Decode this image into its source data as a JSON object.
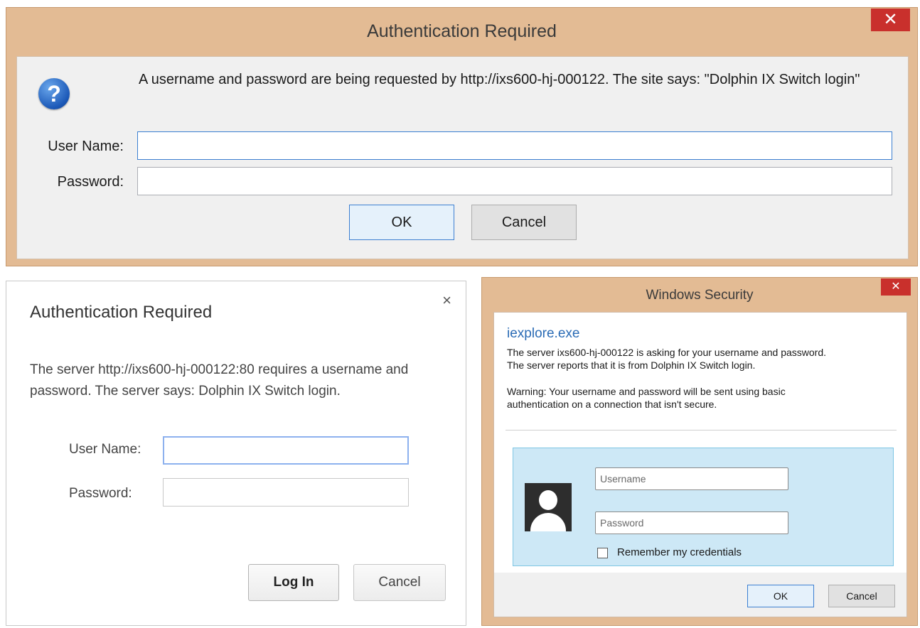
{
  "firefox_dialog": {
    "title": "Authentication Required",
    "close_glyph": "✕",
    "message": "A username and password are being requested by http://ixs600-hj-000122. The site says: \"Dolphin IX Switch login\"",
    "username_label": "User Name:",
    "password_label": "Password:",
    "username_value": "",
    "password_value": "",
    "ok_label": "OK",
    "cancel_label": "Cancel",
    "icon": "question-icon"
  },
  "chrome_dialog": {
    "title": "Authentication Required",
    "close_glyph": "×",
    "message": "The server http://ixs600-hj-000122:80 requires a username and password. The server says: Dolphin IX Switch login.",
    "username_label": "User Name:",
    "password_label": "Password:",
    "username_value": "",
    "password_value": "",
    "login_label": "Log In",
    "cancel_label": "Cancel"
  },
  "windows_security_dialog": {
    "title": "Windows Security",
    "close_glyph": "✕",
    "app_name": "iexplore.exe",
    "line1": "The server ixs600-hj-000122 is asking for your username and password.",
    "line2": "The server reports that it is from Dolphin IX Switch login.",
    "warning1": "Warning: Your username and password will be sent using basic",
    "warning2": "authentication on a connection that isn't secure.",
    "username_placeholder": "Username",
    "password_placeholder": "Password",
    "remember_label": "Remember my credentials",
    "remember_checked": false,
    "ok_label": "OK",
    "cancel_label": "Cancel",
    "icon": "user-avatar-icon"
  },
  "colors": {
    "title_bar": "#e3bb94",
    "close_button": "#c9302c",
    "focus_border": "#3c7fd1",
    "credential_tile": "#cde8f6",
    "link_blue": "#2a6bb5"
  }
}
